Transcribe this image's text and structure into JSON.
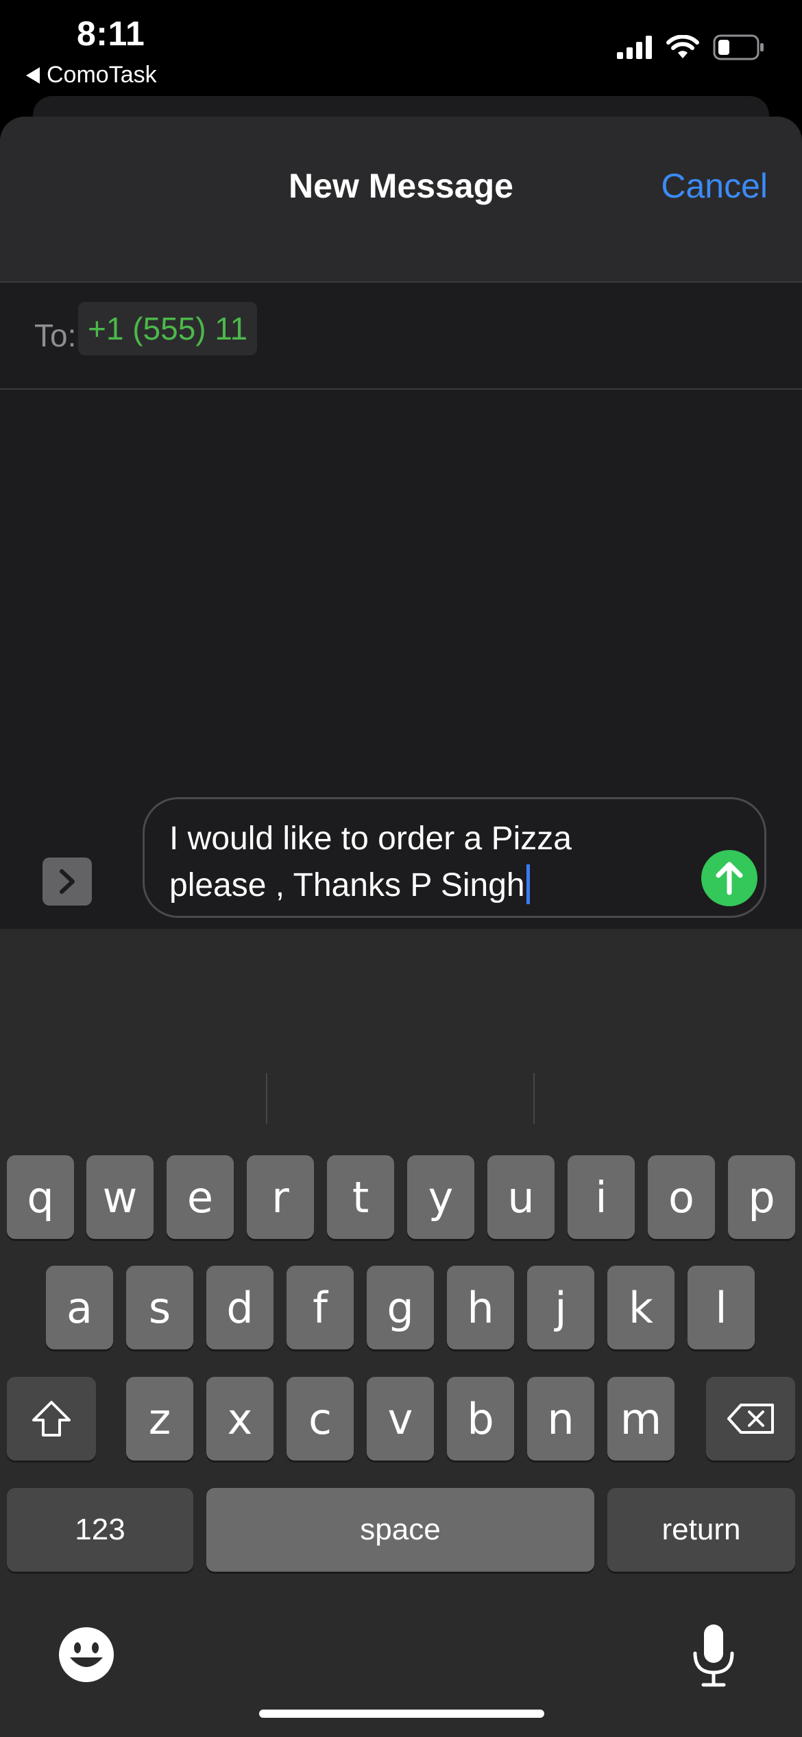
{
  "status_bar": {
    "time": "8:11",
    "back_app": "ComoTask",
    "icons": [
      "cellular-signal-icon",
      "wifi-icon",
      "battery-icon"
    ]
  },
  "header": {
    "title": "New Message",
    "cancel_label": "Cancel"
  },
  "recipients": {
    "to_label": "To:",
    "recipient": "+1 (555) 11"
  },
  "compose": {
    "message_line1": "I would like to order a Pizza",
    "message_line2": "please , Thanks P Singh"
  },
  "keyboard": {
    "row1": [
      "q",
      "w",
      "e",
      "r",
      "t",
      "y",
      "u",
      "i",
      "o",
      "p"
    ],
    "row2": [
      "a",
      "s",
      "d",
      "f",
      "g",
      "h",
      "j",
      "k",
      "l"
    ],
    "row3": [
      "z",
      "x",
      "c",
      "v",
      "b",
      "n",
      "m"
    ],
    "numbers_label": "123",
    "space_label": "space",
    "return_label": "return"
  },
  "colors": {
    "accent_blue": "#3b8bf5",
    "recipient_green": "#4cb84a",
    "send_green": "#34c759",
    "caret_blue": "#3b7bf6"
  }
}
